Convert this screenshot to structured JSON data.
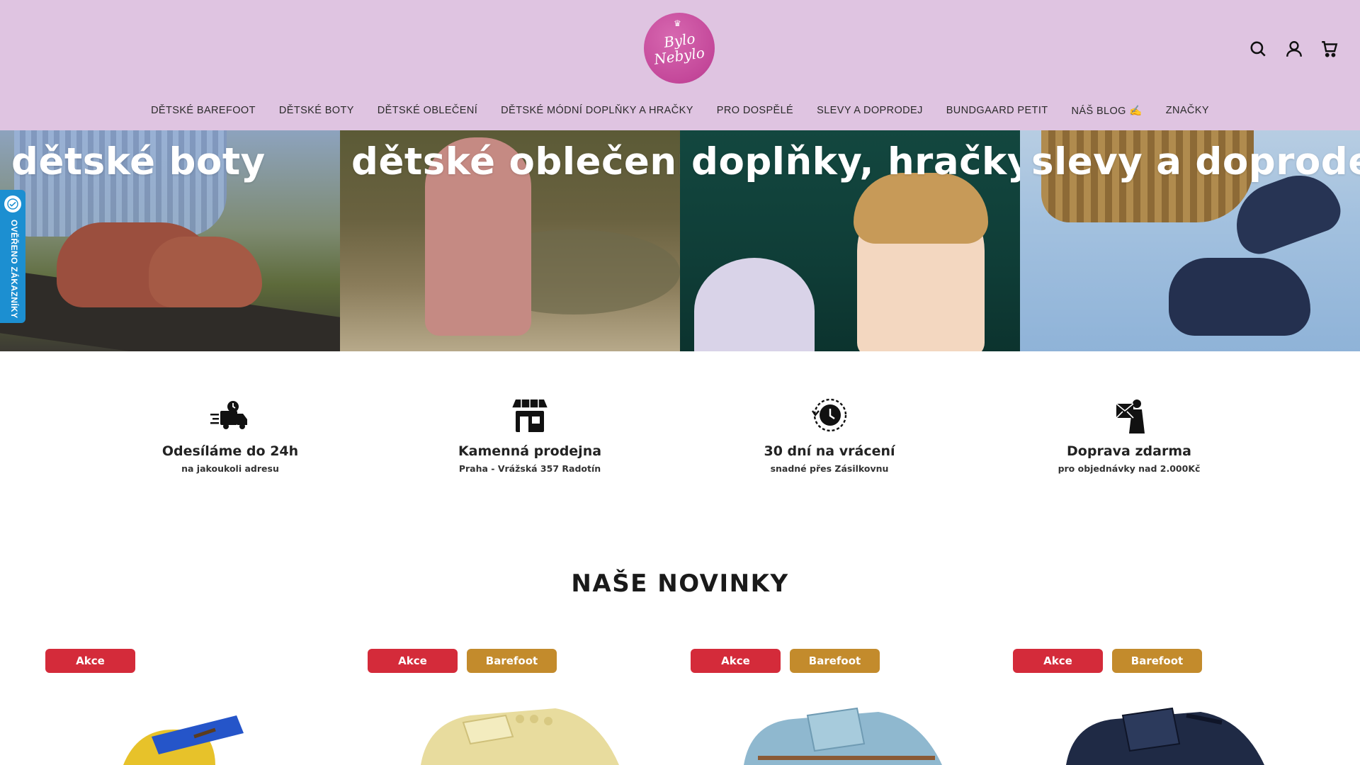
{
  "brand": {
    "logo_line1": "Bylo",
    "logo_line2": "Nebylo"
  },
  "header": {
    "nav": [
      "DĚTSKÉ BAREFOOT",
      "DĚTSKÉ BOTY",
      "DĚTSKÉ OBLEČENÍ",
      "DĚTSKÉ MÓDNÍ DOPLŇKY A HRAČKY",
      "PRO DOSPĚLÉ",
      "SLEVY A DOPRODEJ",
      "BUNDGAARD PETIT",
      "NÁŠ BLOG ✍️",
      "ZNAČKY"
    ],
    "icons": [
      "search-icon",
      "account-icon",
      "cart-icon"
    ]
  },
  "hero": {
    "tiles": [
      {
        "label": "dětské boty"
      },
      {
        "label": "dětské oblečení"
      },
      {
        "label": "doplňky, hračky"
      },
      {
        "label": "slevy a doprodej"
      }
    ]
  },
  "side_tab": {
    "label": "OVĚŘENO ZÁKAZNÍKY"
  },
  "features": [
    {
      "icon": "delivery-truck-icon",
      "title": "Odesíláme do 24h",
      "subtitle": "na jakoukoli adresu"
    },
    {
      "icon": "store-icon",
      "title": "Kamenná prodejna",
      "subtitle": "Praha - Vrážská 357 Radotín"
    },
    {
      "icon": "return-clock-icon",
      "title": "30 dní na vrácení",
      "subtitle": "snadné přes Zásilkovnu"
    },
    {
      "icon": "free-shipping-icon",
      "title": "Doprava zdarma",
      "subtitle": "pro objednávky nad 2.000Kč"
    }
  ],
  "novinky": {
    "title": "NAŠE NOVINKY",
    "products": [
      {
        "badges": [
          "Akce"
        ]
      },
      {
        "badges": [
          "Akce",
          "Barefoot"
        ]
      },
      {
        "badges": [
          "Akce",
          "Barefoot"
        ]
      },
      {
        "badges": [
          "Akce",
          "Barefoot"
        ]
      }
    ]
  },
  "colors": {
    "header_bg": "#dfc4e1",
    "logo": "#c4489a",
    "akce_badge": "#d42b3a",
    "barefoot_badge": "#c38b2c",
    "side_tab": "#1c8fd1"
  }
}
